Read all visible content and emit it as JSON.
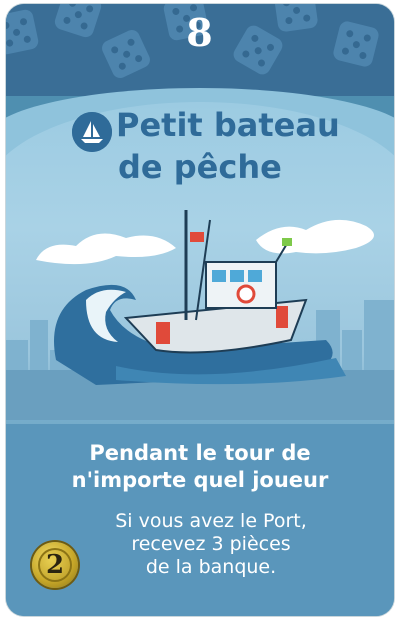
{
  "card": {
    "cost": "8",
    "title_line1": "Petit bateau",
    "title_line2": "de pêche",
    "type_icon": "boat-icon",
    "activation_line1": "Pendant le tour de",
    "activation_line2": "n'importe quel joueur",
    "effect_line1": "Si vous avez le Port,",
    "effect_line2": "recevez 3 pièces",
    "effect_line3": "de la banque.",
    "coin_value": "2",
    "colors": {
      "card_blue": "#4f8fb0",
      "title_blue": "#2f6b99",
      "coin_gold": "#c9a92a"
    }
  }
}
